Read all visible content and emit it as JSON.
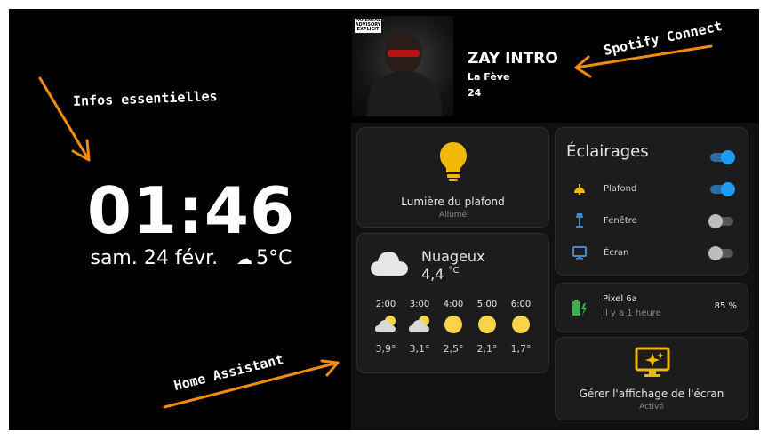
{
  "clock": {
    "time": "01:46",
    "date": "sam. 24 févr.",
    "temperature": "5°C"
  },
  "annotations": {
    "infos": "Infos essentielles",
    "home_assistant": "Home Assistant",
    "spotify": "Spotify Connect"
  },
  "media": {
    "title": "ZAY INTRO",
    "artist": "La Fève",
    "album": "24",
    "progress": 0.07,
    "cover_label": "PARENTAL ADVISORY EXPLICIT CONTENT"
  },
  "lamp": {
    "name": "Lumière du plafond",
    "state": "Allumé",
    "icon": "lightbulb-icon",
    "color": "#f2b807"
  },
  "weather": {
    "condition": "Nuageux",
    "temp": "4,4",
    "unit": "°C",
    "forecast": [
      {
        "time": "2:00",
        "icon": "partly-cloudy-night-icon",
        "temp": "3,9°"
      },
      {
        "time": "3:00",
        "icon": "partly-cloudy-night-icon",
        "temp": "3,1°"
      },
      {
        "time": "4:00",
        "icon": "moon-icon",
        "temp": "2,5°"
      },
      {
        "time": "5:00",
        "icon": "moon-icon",
        "temp": "2,1°"
      },
      {
        "time": "6:00",
        "icon": "moon-icon",
        "temp": "1,7°"
      }
    ]
  },
  "lights": {
    "title": "Éclairages",
    "master_on": true,
    "items": [
      {
        "label": "Plafond",
        "icon": "ceiling-light-icon",
        "on": true
      },
      {
        "label": "Fenêtre",
        "icon": "floor-lamp-icon",
        "on": false
      },
      {
        "label": "Écran",
        "icon": "monitor-icon",
        "on": false
      }
    ]
  },
  "phone": {
    "name": "Pixel 6a",
    "when": "Il y a 1 heure",
    "battery": "85 %",
    "icon": "battery-charging-icon"
  },
  "screen_control": {
    "name": "Gérer l'affichage de l'écran",
    "state": "Activé",
    "icon": "monitor-sparkle-icon"
  },
  "colors": {
    "accent": "#1e9bf0",
    "annotation": "#f28c0f",
    "amber": "#f2b807",
    "moon": "#f7d449"
  }
}
